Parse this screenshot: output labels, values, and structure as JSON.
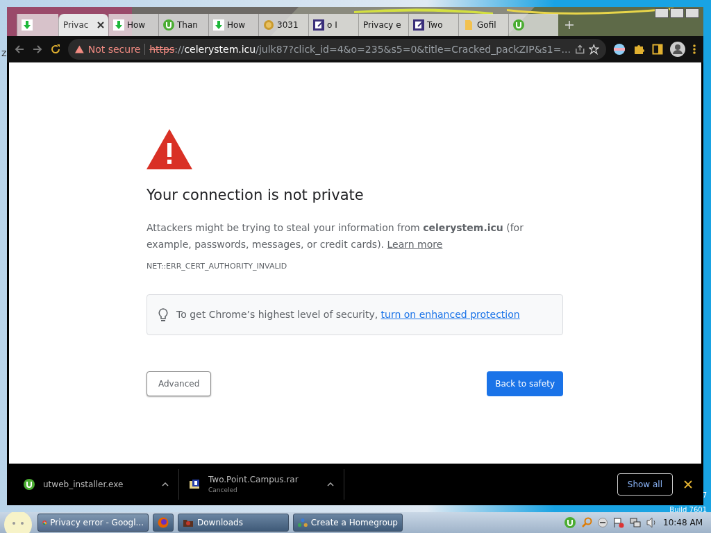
{
  "tabs": [
    {
      "kind": "download",
      "selected": false
    },
    {
      "label": "Privac",
      "selected": true
    },
    {
      "kind": "download",
      "label": "How",
      "selected": false
    },
    {
      "kind": "utorrent",
      "label": "Than",
      "selected": false
    },
    {
      "kind": "download",
      "label": "How",
      "selected": false
    },
    {
      "kind": "coin",
      "label": "3031",
      "selected": false
    },
    {
      "kind": "note",
      "label": "o I",
      "selected": false
    },
    {
      "label": "Privacy e",
      "selected": false
    },
    {
      "kind": "note",
      "label": "Two",
      "selected": false
    },
    {
      "kind": "file",
      "label": "Gofil",
      "selected": false
    },
    {
      "kind": "utorrent",
      "selected": false
    }
  ],
  "address_bar": {
    "security": "Not secure",
    "scheme": "https",
    "separator": "://",
    "host": "celerystem.icu",
    "path": "/julk87?click_id=4&o=235&s5=0&title=Cracked_packZIP&s1=..."
  },
  "page": {
    "title": "Your connection is not private",
    "body": "Attackers might be trying to steal your information from **celerystem.icu** (for example, passwords, messages, or credit cards).",
    "learn_more": "Learn more",
    "error_code": "NET::ERR_CERT_AUTHORITY_INVALID",
    "tip_text": "To get Chrome’s highest level of security,",
    "tip_link": "turn on enhanced protection",
    "advanced_button": "Advanced",
    "back_button": "Back to safety"
  },
  "downloads": [
    {
      "kind": "utorrent",
      "name": "utweb_installer.exe"
    },
    {
      "kind": "rar",
      "name": "Two.Point.Campus.rar",
      "status": "Canceled"
    }
  ],
  "show_all": "Show all",
  "desktop": {
    "left_text": "Z",
    "corner_text": "7",
    "build": "Build 7601"
  },
  "taskbar": {
    "items": [
      {
        "kind": "chrome",
        "label": "Privacy error - Googl...",
        "selected": true
      },
      {
        "kind": "firefox",
        "selected": false
      },
      {
        "kind": "folder",
        "label": "Downloads",
        "selected": false
      },
      {
        "kind": "network",
        "label": "Create a Homegroup",
        "selected": false
      }
    ],
    "clock": "10:48 AM"
  }
}
